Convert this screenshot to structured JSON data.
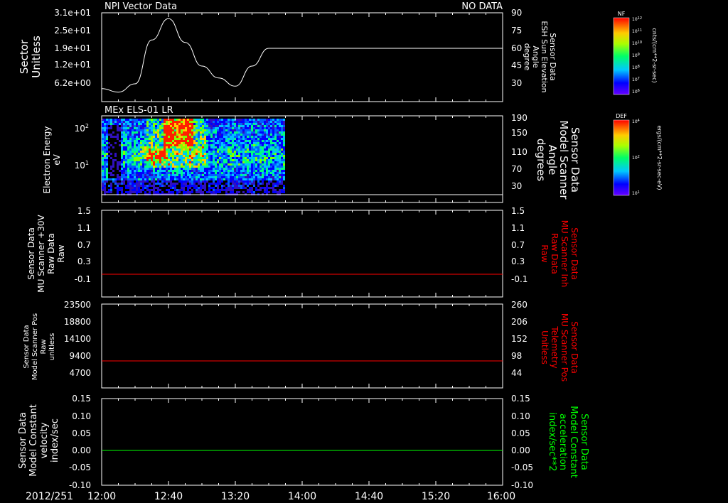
{
  "panel1": {
    "title": "NPI Vector Data",
    "status": "NO DATA",
    "left_label_1": "Sector",
    "left_label_2": "Unitless",
    "right_label": [
      "Sensor Data",
      "ESH Sun Elevation",
      "Angle",
      "degree"
    ],
    "left_ticks": [
      "3.1e+01",
      "2.5e+01",
      "1.9e+01",
      "1.2e+01",
      "6.2e+00"
    ],
    "right_ticks": [
      "90",
      "75",
      "60",
      "45",
      "30"
    ]
  },
  "panel2": {
    "title": "MEx ELS-01 LR",
    "left_label": [
      "Electron Energy",
      "eV"
    ],
    "right_label": [
      "Sensor Data",
      "Model Scanner",
      "Angle",
      "degrees"
    ],
    "left_ticks": [
      "10^2",
      "10^1"
    ],
    "right_ticks": [
      "190",
      "150",
      "110",
      "70",
      "30"
    ]
  },
  "panel3": {
    "left_label": [
      "Sensor Data",
      "MU Scanner +30V",
      "Raw Data",
      "Raw"
    ],
    "right_label": [
      "Sensor Data",
      "MU Scanner Inh",
      "Raw Data",
      "Raw"
    ],
    "left_ticks": [
      "1.5",
      "1.1",
      "0.7",
      "0.3",
      "-0.1"
    ],
    "right_ticks": [
      "1.5",
      "1.1",
      "0.7",
      "0.3",
      "-0.1"
    ]
  },
  "panel4": {
    "left_label": [
      "Sensor Data",
      "Model Scanner Pos",
      "Raw",
      "unitless"
    ],
    "right_label": [
      "Sensor Data",
      "MU Scanner Pos",
      "Telemetry",
      "Unitless"
    ],
    "left_ticks": [
      "23500",
      "18800",
      "14100",
      "9400",
      "4700"
    ],
    "right_ticks": [
      "260",
      "206",
      "152",
      "98",
      "44"
    ]
  },
  "panel5": {
    "left_label": [
      "Sensor Data",
      "Model Constant",
      "velocity",
      "index/sec"
    ],
    "right_label": [
      "Sensor Data",
      "Model Constant",
      "acceleration",
      "index/sec**2"
    ],
    "left_ticks": [
      "0.15",
      "0.10",
      "0.05",
      "0.00",
      "-0.05",
      "-0.10"
    ],
    "right_ticks": [
      "0.15",
      "0.10",
      "0.05",
      "0.00",
      "-0.05",
      "-0.10"
    ]
  },
  "x_axis": {
    "date_label": "2012/251",
    "ticks": [
      "12:00",
      "12:40",
      "13:20",
      "14:00",
      "14:40",
      "15:20",
      "16:00"
    ]
  },
  "colorbar1": {
    "label": "NF",
    "units": "cnts/(cm**2-sr-sec)",
    "ticks": [
      "10^12",
      "10^11",
      "10^10",
      "10^9",
      "10^8",
      "10^7",
      "10^6"
    ]
  },
  "colorbar2": {
    "label": "DEF",
    "units": "ergs/(cm**2-sr-sec-eV)",
    "ticks": [
      "10^4",
      "10^2",
      "10^1"
    ]
  },
  "colors": {
    "background": "#000000",
    "axes": "#ffffff",
    "red_trace": "#ff0000",
    "green_trace": "#00ff00",
    "red_label": "#ff0000",
    "green_label": "#00ff00"
  },
  "chart_data": [
    {
      "type": "line",
      "title": "NPI Vector Data",
      "ylabel": "Sensor Data ESH Sun Elevation Angle degree",
      "x": [
        "12:00",
        "12:10",
        "12:20",
        "12:30",
        "12:40",
        "12:50",
        "13:00",
        "13:10",
        "13:20",
        "13:30",
        "13:40",
        "13:50",
        "14:00",
        "14:40",
        "15:20",
        "16:00"
      ],
      "values": [
        26,
        23,
        30,
        67,
        85,
        65,
        45,
        35,
        28,
        45,
        60,
        60,
        60,
        60,
        60,
        60
      ],
      "ylim": [
        15,
        90
      ],
      "xlim": [
        "12:00",
        "16:00"
      ]
    },
    {
      "type": "heatmap",
      "title": "MEx ELS-01 LR",
      "ylabel": "Electron Energy eV",
      "xlim": [
        "12:00",
        "13:47"
      ],
      "ylim": [
        1,
        150
      ],
      "yscale": "log"
    },
    {
      "type": "line",
      "ylabel": "Sensor Data MU Scanner Inh Raw Data Raw",
      "x": [
        "12:00",
        "16:00"
      ],
      "values": [
        -0.06,
        -0.06
      ],
      "ylim": [
        -0.3,
        1.5
      ]
    },
    {
      "type": "line",
      "ylabel": "Sensor Data MU Scanner Pos Telemetry Unitless",
      "x": [
        "12:00",
        "16:00"
      ],
      "values": [
        88,
        88
      ],
      "ylim": [
        0,
        260
      ]
    },
    {
      "type": "line",
      "ylabel": "Sensor Data Model Constant acceleration index/sec**2",
      "x": [
        "12:00",
        "16:00"
      ],
      "values": [
        0.0,
        0.0
      ],
      "ylim": [
        -0.1,
        0.15
      ]
    }
  ]
}
